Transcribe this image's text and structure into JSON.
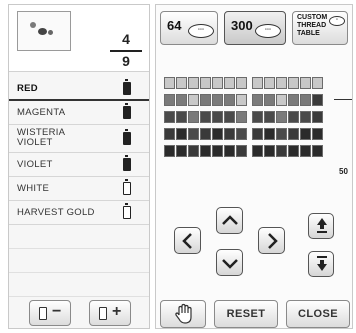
{
  "counter": {
    "current": "4",
    "total": "9"
  },
  "threads": [
    {
      "name": "RED",
      "status": "sewn"
    },
    {
      "name": "MAGENTA",
      "status": "sewn"
    },
    {
      "name": "WISTERIA VIOLET",
      "line1": "WISTERIA",
      "line2": "VIOLET",
      "status": "sewn"
    },
    {
      "name": "VIOLET",
      "status": "sewn"
    },
    {
      "name": "WHITE",
      "status": "unsewn"
    },
    {
      "name": "HARVEST GOLD",
      "status": "unsewn"
    }
  ],
  "selected_thread": "RED",
  "thread_tables": [
    {
      "label": "64",
      "icon": "spool-set-icon"
    },
    {
      "label": "300",
      "icon": "spool-set-icon",
      "selected": true
    },
    {
      "label_lines": [
        "CUSTOM",
        "THREAD",
        "TABLE"
      ],
      "icon": "custom-table-icon"
    }
  ],
  "palette": {
    "page_label": "50",
    "colors": [
      "#c8c8c8",
      "#7a7a7a",
      "#4a4a4a",
      "#3a3a3a",
      "#2b2b2b"
    ]
  },
  "buttons": {
    "reset": "RESET",
    "close": "CLOSE",
    "remove_thread": "−",
    "add_thread": "+"
  }
}
